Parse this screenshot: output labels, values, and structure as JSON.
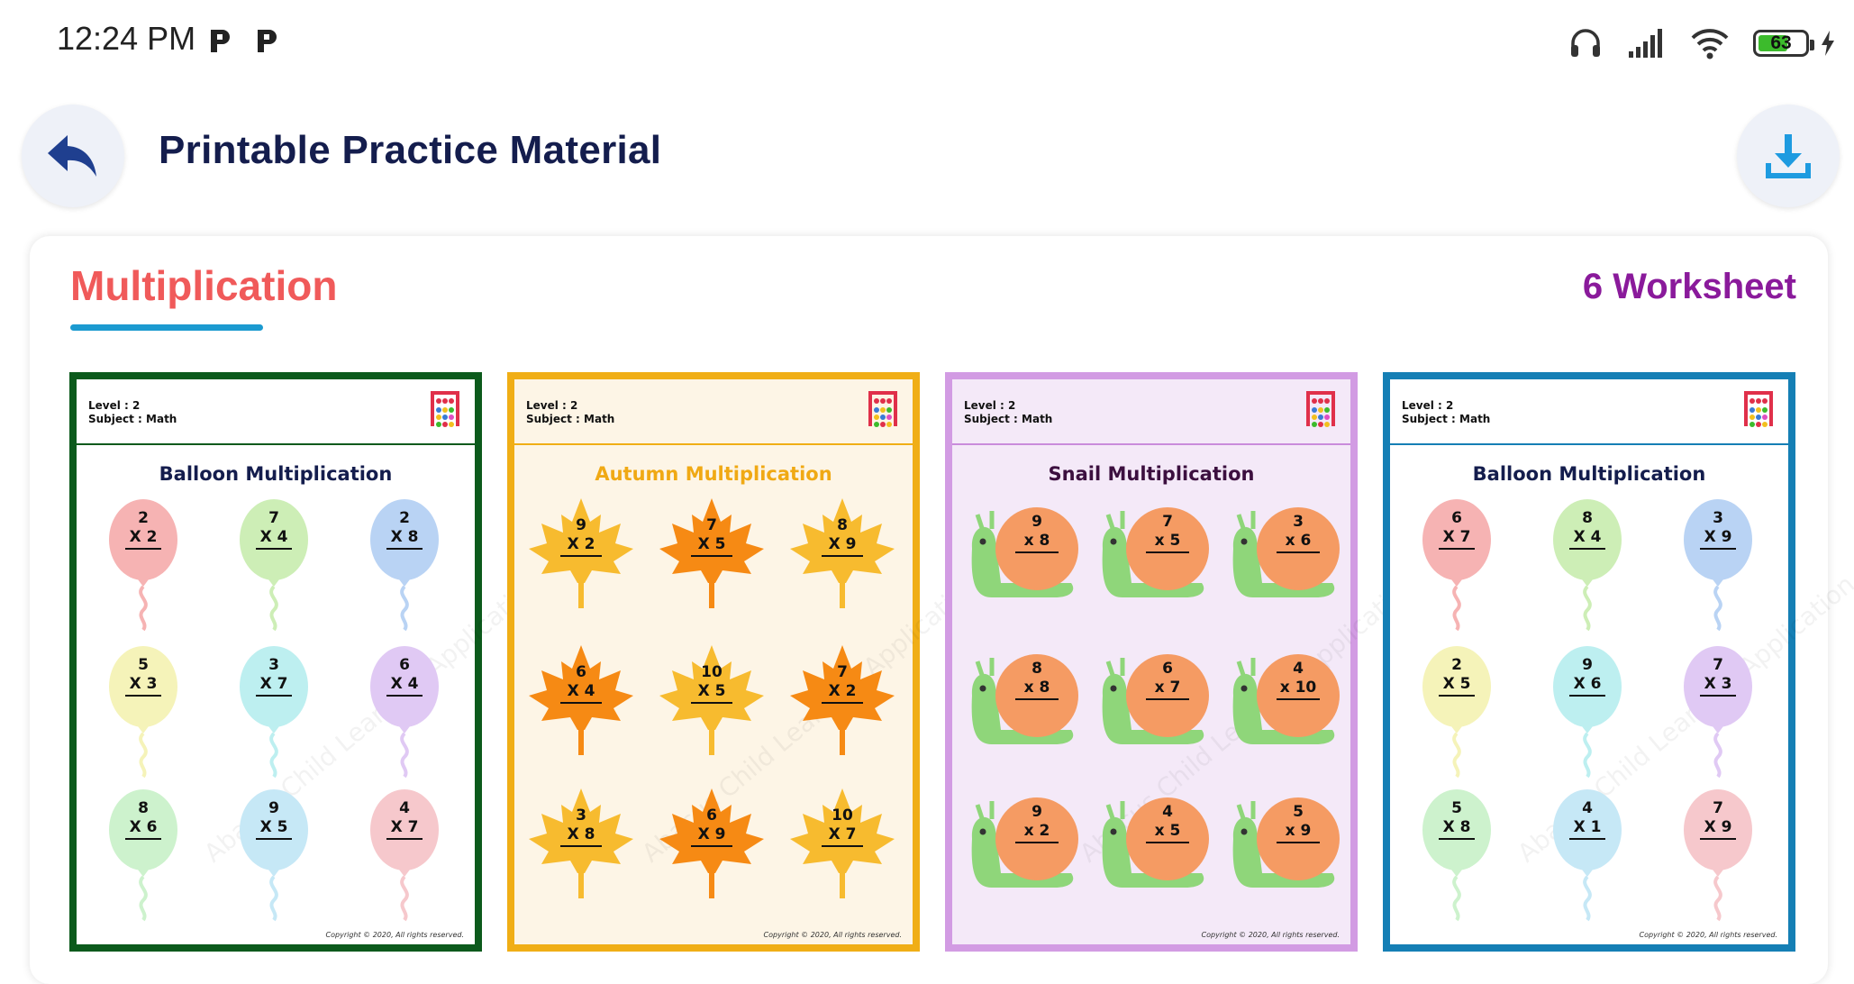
{
  "status_bar": {
    "time": "12:24 PM",
    "battery_level": "63",
    "battery_percent": 63
  },
  "header": {
    "title": "Printable Practice Material"
  },
  "section": {
    "title": "Multiplication",
    "count": "6 Worksheet"
  },
  "colors": {
    "title": "#141d4d",
    "section_title": "#f05a5a",
    "underline": "#1b9ad0",
    "count": "#8a1a9b",
    "download": "#1e9be0",
    "back": "#1f3f8f"
  },
  "worksheets": [
    {
      "level": "Level : 2",
      "subject": "Subject : Math",
      "title": "Balloon Multiplication",
      "style": "balloon",
      "border": "#0c5a1c",
      "bg": "#ffffff",
      "title_color": "#141d4d",
      "head_border": "#0c5a1c",
      "copyright": "Copyright © 2020, All rights reserved.",
      "items": [
        {
          "top": "2",
          "bottom": "X 2",
          "color": "#f6b3b3"
        },
        {
          "top": "7",
          "bottom": "X 4",
          "color": "#cdeeb6"
        },
        {
          "top": "2",
          "bottom": "X 8",
          "color": "#b9d3f4"
        },
        {
          "top": "5",
          "bottom": "X 3",
          "color": "#f5f3b9"
        },
        {
          "top": "3",
          "bottom": "X 7",
          "color": "#bdeff0"
        },
        {
          "top": "6",
          "bottom": "X 4",
          "color": "#e0c9f4"
        },
        {
          "top": "8",
          "bottom": "X 6",
          "color": "#cdf2cd"
        },
        {
          "top": "9",
          "bottom": "X 5",
          "color": "#c6e8f6"
        },
        {
          "top": "4",
          "bottom": "X 7",
          "color": "#f6c8cc"
        }
      ]
    },
    {
      "level": "Level : 2",
      "subject": "Subject : Math",
      "title": "Autumn Multiplication",
      "style": "leaf",
      "border": "#f0ae16",
      "bg": "#fdf5e6",
      "title_color": "#f0a914",
      "head_border": "#f0ae16",
      "copyright": "Copyright © 2020, All rights reserved.",
      "items": [
        {
          "top": "9",
          "bottom": "X 2",
          "color": "#f7bb2f"
        },
        {
          "top": "7",
          "bottom": "X 5",
          "color": "#f68a14"
        },
        {
          "top": "8",
          "bottom": "X 9",
          "color": "#f7bb2f"
        },
        {
          "top": "6",
          "bottom": "X 4",
          "color": "#f68a14"
        },
        {
          "top": "10",
          "bottom": "X 5",
          "color": "#f7bb2f"
        },
        {
          "top": "7",
          "bottom": "X 2",
          "color": "#f68a14"
        },
        {
          "top": "3",
          "bottom": "X 8",
          "color": "#f7bb2f"
        },
        {
          "top": "6",
          "bottom": "X 9",
          "color": "#f68a14"
        },
        {
          "top": "10",
          "bottom": "X 7",
          "color": "#f7bb2f"
        }
      ]
    },
    {
      "level": "Level : 2",
      "subject": "Subject : Math",
      "title": "Snail Multiplication",
      "style": "snail",
      "border": "#d29be3",
      "bg": "#f4e9f8",
      "title_color": "#3c0f3f",
      "head_border": "#c98bdb",
      "copyright": "Copyright © 2020, All rights reserved.",
      "items": [
        {
          "top": "9",
          "bottom": "x 8",
          "color": "#f59b63"
        },
        {
          "top": "7",
          "bottom": "x 5",
          "color": "#f59b63"
        },
        {
          "top": "3",
          "bottom": "x 6",
          "color": "#f59b63"
        },
        {
          "top": "8",
          "bottom": "x 8",
          "color": "#f59b63"
        },
        {
          "top": "6",
          "bottom": "x 7",
          "color": "#f59b63"
        },
        {
          "top": "4",
          "bottom": "x 10",
          "color": "#f59b63"
        },
        {
          "top": "9",
          "bottom": "x 2",
          "color": "#f59b63"
        },
        {
          "top": "4",
          "bottom": "x 5",
          "color": "#f59b63"
        },
        {
          "top": "5",
          "bottom": "x 9",
          "color": "#f59b63"
        }
      ]
    },
    {
      "level": "Level : 2",
      "subject": "Subject : Math",
      "title": "Balloon Multiplication",
      "style": "balloon",
      "border": "#157fb5",
      "bg": "#ffffff",
      "title_color": "#141d4d",
      "head_border": "#157fb5",
      "copyright": "Copyright © 2020, All rights reserved.",
      "items": [
        {
          "top": "6",
          "bottom": "X 7",
          "color": "#f6b3b3"
        },
        {
          "top": "8",
          "bottom": "X 4",
          "color": "#cdeeb6"
        },
        {
          "top": "3",
          "bottom": "X 9",
          "color": "#b9d3f4"
        },
        {
          "top": "2",
          "bottom": "X 5",
          "color": "#f5f3b9"
        },
        {
          "top": "9",
          "bottom": "X 6",
          "color": "#bdeff0"
        },
        {
          "top": "7",
          "bottom": "X 3",
          "color": "#e0c9f4"
        },
        {
          "top": "5",
          "bottom": "X 8",
          "color": "#cdf2cd"
        },
        {
          "top": "4",
          "bottom": "X 1",
          "color": "#c6e8f6"
        },
        {
          "top": "7",
          "bottom": "X 9",
          "color": "#f6c8cc"
        }
      ]
    }
  ]
}
